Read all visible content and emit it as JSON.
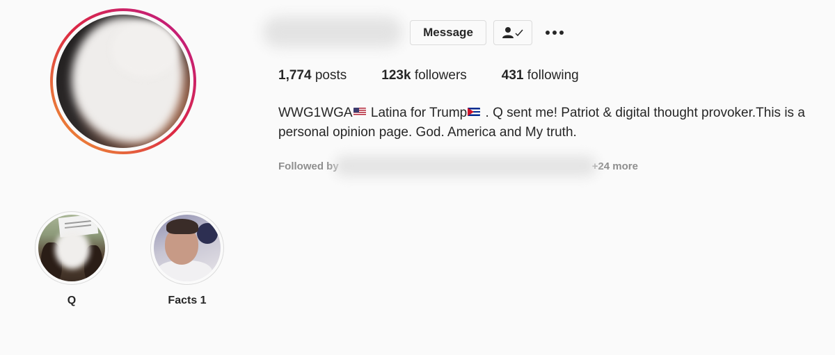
{
  "profile": {
    "avatar_icon": "profile-photo-redacted"
  },
  "header": {
    "message_label": "Message",
    "following_icon": "person-check-icon",
    "more_icon": "more-options-icon"
  },
  "stats": {
    "posts_count": "1,774",
    "posts_label": "posts",
    "followers_count": "123k",
    "followers_label": "followers",
    "following_count": "431",
    "following_label": "following"
  },
  "bio": {
    "part1": "WWG1WGA",
    "part2": " Latina for Trump",
    "part3": " . Q sent me! Patriot & digital thought provoker.This is a personal opinion page. God. America and My truth."
  },
  "followed_by": {
    "prefix": "Followed by ",
    "suffix": " +24 more"
  },
  "highlights": [
    {
      "label": "Q"
    },
    {
      "label": "Facts 1"
    }
  ],
  "colors": {
    "text": "#262626",
    "muted": "#8e8e8e",
    "border": "#dbdbdb",
    "background": "#fafafa"
  }
}
